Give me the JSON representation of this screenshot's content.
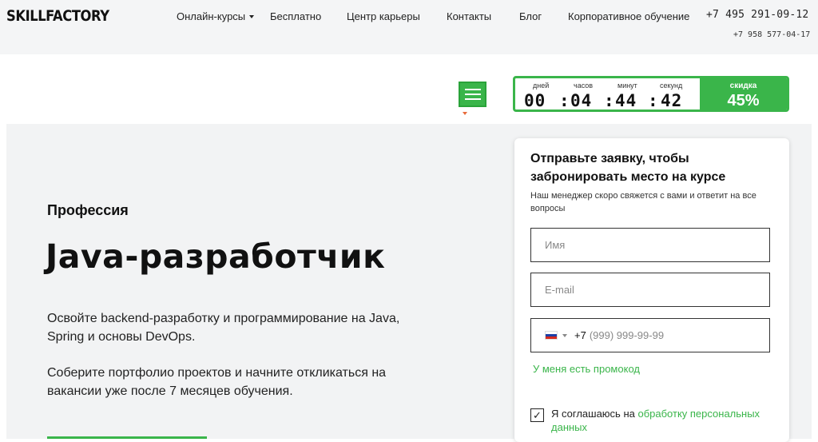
{
  "header": {
    "logo_text": "SKILLFACTORY",
    "nav": [
      {
        "label": "Онлайн-курсы",
        "has_dropdown": true
      },
      {
        "label": "Бесплатно"
      },
      {
        "label": "Центр карьеры"
      },
      {
        "label": "Контакты"
      },
      {
        "label": "Блог"
      },
      {
        "label": "Корпоративное обучение"
      }
    ],
    "phone_primary": "+7 495 291-09-12",
    "phone_secondary": "+7 958 577-04-17"
  },
  "timer": {
    "labels": [
      "дней",
      "часов",
      "минут",
      "секунд"
    ],
    "values": [
      "00",
      "04",
      "44",
      "42"
    ],
    "separator": ":",
    "sale_label": "скидка",
    "sale_value": "45%"
  },
  "hero": {
    "eyebrow": "Профессия",
    "title": "Java-разработчик",
    "description_1": "Освойте backend-разработку и программирование на Java, Spring и основы DevOps.",
    "description_2": "Соберите портфолио проектов и начните откликаться на вакансии уже после 7 месяцев обучения."
  },
  "form": {
    "title": "Отправьте заявку, чтобы забронировать место на курсе",
    "subtitle": "Наш менеджер скоро свяжется с вами и ответит на все вопросы",
    "name_placeholder": "Имя",
    "email_placeholder": "E-mail",
    "phone_code": "+7",
    "phone_placeholder": "(999) 999-99-99",
    "promo_link": "У меня есть промокод",
    "consent_text": "Я соглашаюсь на ",
    "consent_link": "обработку персональных данных",
    "consent_checked": true
  },
  "colors": {
    "accent": "#3ab54a",
    "topbar_bg": "#f4f5f6",
    "hero_bg": "#f2f3f4"
  }
}
